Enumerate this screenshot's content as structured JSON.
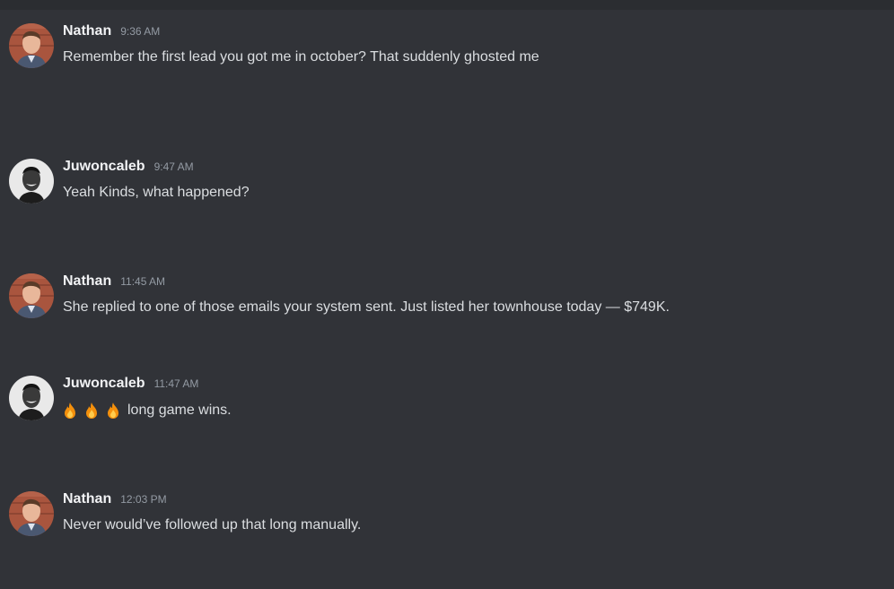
{
  "messages": [
    {
      "author": "Nathan",
      "time": "9:36 AM",
      "text": "Remember the first lead you got me in october? That suddenly ghosted me",
      "avatar": "nathan-avatar"
    },
    {
      "author": "Juwoncaleb",
      "time": "9:47 AM",
      "text": "Yeah Kinds, what happened?",
      "avatar": "juwoncaleb-avatar"
    },
    {
      "author": "Nathan",
      "time": "11:45 AM",
      "text": "She replied to one of those emails your system sent. Just listed her townhouse today — $749K.",
      "avatar": "nathan-avatar"
    },
    {
      "author": "Juwoncaleb",
      "time": "11:47 AM",
      "text": "long game wins.",
      "emoji": [
        "fire-icon",
        "fire-icon",
        "fire-icon"
      ],
      "avatar": "juwoncaleb-avatar"
    },
    {
      "author": "Nathan",
      "time": "12:03 PM",
      "text": "Never would’ve followed up that long manually.",
      "avatar": "nathan-avatar"
    }
  ],
  "colors": {
    "background": "#313338",
    "author": "#f2f3f5",
    "timestamp": "#949ba4",
    "message_text": "#dbdee1",
    "fire": "#f4900c"
  }
}
